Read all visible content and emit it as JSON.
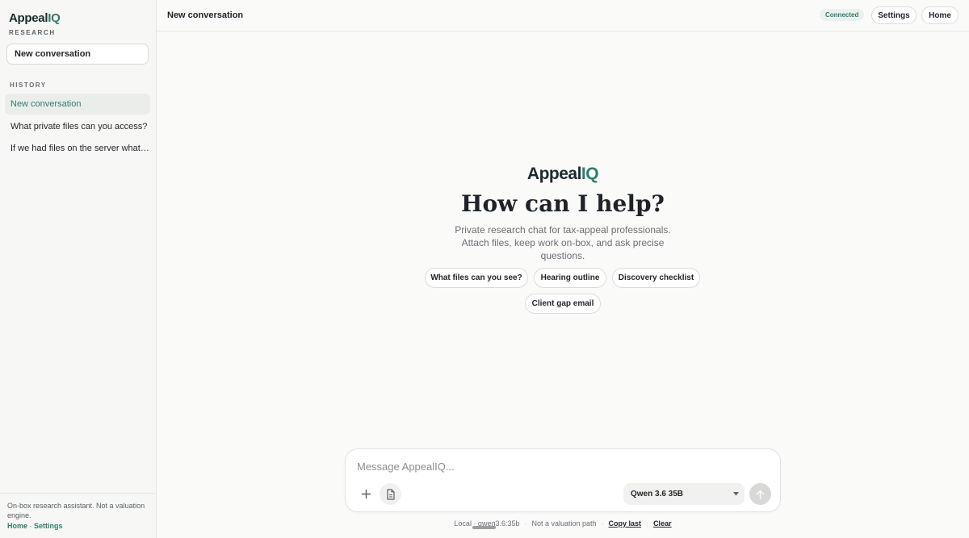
{
  "sidebar": {
    "brand_prefix": "Appeal",
    "brand_suffix": "IQ",
    "brand_sub": "RESEARCH",
    "new_conversation_label": "New conversation",
    "history_label": "HISTORY",
    "history_items": [
      {
        "label": "New conversation"
      },
      {
        "label": "What private files can you access?"
      },
      {
        "label": "If we had files on the server what would you do?"
      }
    ],
    "footer_note": "On-box research assistant. Not a valuation engine.",
    "footer_home": "Home",
    "footer_sep": "·",
    "footer_settings": "Settings"
  },
  "topbar": {
    "title": "New conversation",
    "status": "Connected",
    "settings_label": "Settings",
    "home_label": "Home"
  },
  "hero": {
    "logo_prefix": "Appeal",
    "logo_suffix": "IQ",
    "title": "How can I help?",
    "subtitle": "Private research chat for tax-appeal professionals. Attach files, keep work on-box, and ask precise questions."
  },
  "chips": [
    {
      "label": "What files can you see?"
    },
    {
      "label": "Hearing outline"
    },
    {
      "label": "Discovery checklist"
    },
    {
      "label": "Client gap email"
    }
  ],
  "composer": {
    "placeholder": "Message AppealIQ...",
    "model": "Qwen 3.6 35B",
    "plus_icon": "plus-icon",
    "file_icon": "document-icon",
    "send_icon": "arrow-up-icon"
  },
  "footer": {
    "local": "Local · qwen3.6:35b",
    "note": "Not a valuation path",
    "copy_last": "Copy last",
    "clear": "Clear",
    "sep": "·"
  },
  "colors": {
    "accent": "#2f7d6d",
    "background": "#fafaf9",
    "sidebar": "#f7f7f6"
  }
}
